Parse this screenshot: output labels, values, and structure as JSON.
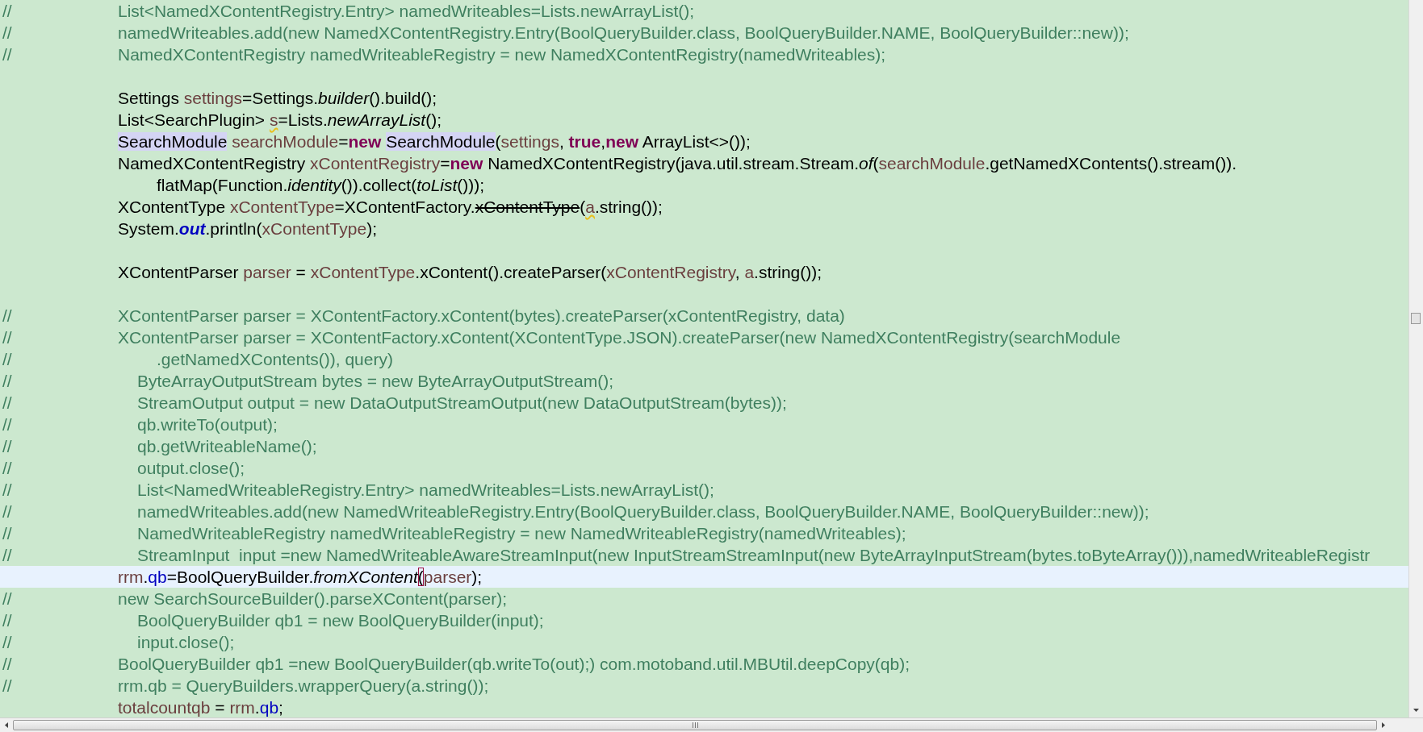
{
  "editor": {
    "lines": [
      {
        "kind": "comment",
        "current": false,
        "marker": "//",
        "text": "List<NamedXContentRegistry.Entry> namedWriteables=Lists.newArrayList();"
      },
      {
        "kind": "comment",
        "current": false,
        "marker": "//",
        "text": "namedWriteables.add(new NamedXContentRegistry.Entry(BoolQueryBuilder.class, BoolQueryBuilder.NAME, BoolQueryBuilder::new));"
      },
      {
        "kind": "comment",
        "current": false,
        "marker": "//",
        "text": "NamedXContentRegistry namedWriteableRegistry = new NamedXContentRegistry(namedWriteables);"
      },
      {
        "kind": "blank",
        "current": false
      },
      {
        "kind": "code",
        "current": false,
        "tokens": [
          {
            "text": "Settings ",
            "kind": "plain"
          },
          {
            "text": "settings",
            "kind": "local"
          },
          {
            "text": "=Settings.",
            "kind": "plain"
          },
          {
            "text": "builder",
            "kind": "static"
          },
          {
            "text": "().build();",
            "kind": "plain"
          }
        ]
      },
      {
        "kind": "code",
        "current": false,
        "tokens": [
          {
            "text": "List<SearchPlugin> ",
            "kind": "plain"
          },
          {
            "text": "s",
            "kind": "local-warning"
          },
          {
            "text": "=Lists.",
            "kind": "plain"
          },
          {
            "text": "newArrayList",
            "kind": "static"
          },
          {
            "text": "();",
            "kind": "plain"
          }
        ]
      },
      {
        "kind": "code",
        "current": false,
        "tokens": [
          {
            "text": "SearchModule",
            "kind": "occurrence"
          },
          {
            "text": " searchModule",
            "kind": "local"
          },
          {
            "text": "=",
            "kind": "plain"
          },
          {
            "text": "new ",
            "kind": "keyword"
          },
          {
            "text": "SearchModule",
            "kind": "occurrence"
          },
          {
            "text": "(",
            "kind": "plain"
          },
          {
            "text": "settings",
            "kind": "local"
          },
          {
            "text": ", ",
            "kind": "plain"
          },
          {
            "text": "true",
            "kind": "keyword"
          },
          {
            "text": ",",
            "kind": "plain"
          },
          {
            "text": "new",
            "kind": "keyword"
          },
          {
            "text": " ArrayList<>());",
            "kind": "plain"
          }
        ]
      },
      {
        "kind": "code",
        "current": false,
        "tokens": [
          {
            "text": "NamedXContentRegistry ",
            "kind": "plain"
          },
          {
            "text": "xContentRegistry",
            "kind": "local"
          },
          {
            "text": "=",
            "kind": "plain"
          },
          {
            "text": "new",
            "kind": "keyword"
          },
          {
            "text": " NamedXContentRegistry(java.util.stream.Stream.",
            "kind": "plain"
          },
          {
            "text": "of",
            "kind": "static"
          },
          {
            "text": "(",
            "kind": "plain"
          },
          {
            "text": "searchModule",
            "kind": "local"
          },
          {
            "text": ".getNamedXContents().stream()).",
            "kind": "plain"
          }
        ]
      },
      {
        "kind": "code-wrapped",
        "current": false,
        "tokens": [
          {
            "text": "flatMap(Function.",
            "kind": "plain"
          },
          {
            "text": "identity",
            "kind": "static"
          },
          {
            "text": "()).collect(",
            "kind": "plain"
          },
          {
            "text": "toList",
            "kind": "static"
          },
          {
            "text": "()));",
            "kind": "plain"
          }
        ]
      },
      {
        "kind": "code",
        "current": false,
        "tokens": [
          {
            "text": "XContentType ",
            "kind": "plain"
          },
          {
            "text": "xContentType",
            "kind": "local"
          },
          {
            "text": "=XContentFactory.",
            "kind": "plain"
          },
          {
            "text": "xContentType",
            "kind": "deprecated"
          },
          {
            "text": "(",
            "kind": "plain"
          },
          {
            "text": "a",
            "kind": "local-warning"
          },
          {
            "text": ".string());",
            "kind": "plain"
          }
        ]
      },
      {
        "kind": "code",
        "current": false,
        "tokens": [
          {
            "text": "System.",
            "kind": "plain"
          },
          {
            "text": "out",
            "kind": "static-field"
          },
          {
            "text": ".println(",
            "kind": "plain"
          },
          {
            "text": "xContentType",
            "kind": "local"
          },
          {
            "text": ");",
            "kind": "plain"
          }
        ]
      },
      {
        "kind": "blank",
        "current": false
      },
      {
        "kind": "code",
        "current": false,
        "tokens": [
          {
            "text": "XContentParser ",
            "kind": "plain"
          },
          {
            "text": "parser",
            "kind": "local"
          },
          {
            "text": " = ",
            "kind": "plain"
          },
          {
            "text": "xContentType",
            "kind": "local"
          },
          {
            "text": ".xContent().createParser(",
            "kind": "plain"
          },
          {
            "text": "xContentRegistry",
            "kind": "local"
          },
          {
            "text": ", ",
            "kind": "plain"
          },
          {
            "text": "a",
            "kind": "local"
          },
          {
            "text": ".string());",
            "kind": "plain"
          }
        ]
      },
      {
        "kind": "blank",
        "current": false
      },
      {
        "kind": "comment",
        "current": false,
        "marker": "//",
        "text": "XContentParser parser = XContentFactory.xContent(bytes).createParser(xContentRegistry, data)"
      },
      {
        "kind": "comment",
        "current": false,
        "marker": "//",
        "text": "XContentParser parser = XContentFactory.xContent(XContentType.JSON).createParser(new NamedXContentRegistry(searchModule"
      },
      {
        "kind": "comment-wrapped",
        "current": false,
        "marker": "//",
        "text": ".getNamedXContents()), query)"
      },
      {
        "kind": "comment-nested",
        "current": false,
        "marker": "//",
        "text": "ByteArrayOutputStream bytes = new ByteArrayOutputStream();"
      },
      {
        "kind": "comment-nested",
        "current": false,
        "marker": "//",
        "text": "StreamOutput output = new DataOutputStreamOutput(new DataOutputStream(bytes));"
      },
      {
        "kind": "comment-nested",
        "current": false,
        "marker": "//",
        "text": "qb.writeTo(output);"
      },
      {
        "kind": "comment-nested",
        "current": false,
        "marker": "//",
        "text": "qb.getWriteableName();"
      },
      {
        "kind": "comment-nested",
        "current": false,
        "marker": "//",
        "text": "output.close();"
      },
      {
        "kind": "comment-nested",
        "current": false,
        "marker": "//",
        "text": "List<NamedWriteableRegistry.Entry> namedWriteables=Lists.newArrayList();"
      },
      {
        "kind": "comment-nested",
        "current": false,
        "marker": "//",
        "text": "namedWriteables.add(new NamedWriteableRegistry.Entry(BoolQueryBuilder.class, BoolQueryBuilder.NAME, BoolQueryBuilder::new));"
      },
      {
        "kind": "comment-nested",
        "current": false,
        "marker": "//",
        "text": "NamedWriteableRegistry namedWriteableRegistry = new NamedWriteableRegistry(namedWriteables);"
      },
      {
        "kind": "comment-nested",
        "current": false,
        "marker": "//",
        "text": "StreamInput  input =new NamedWriteableAwareStreamInput(new InputStreamStreamInput(new ByteArrayInputStream(bytes.toByteArray())),namedWriteableRegistr"
      },
      {
        "kind": "code",
        "current": true,
        "tokens": [
          {
            "text": "rrm",
            "kind": "local"
          },
          {
            "text": ".",
            "kind": "plain"
          },
          {
            "text": "qb",
            "kind": "field"
          },
          {
            "text": "=BoolQueryBuilder.",
            "kind": "plain"
          },
          {
            "text": "fromXContent",
            "kind": "static"
          },
          {
            "text": "(",
            "kind": "bracket-match"
          },
          {
            "text": "parser",
            "kind": "local"
          },
          {
            "text": ");",
            "kind": "plain"
          }
        ]
      },
      {
        "kind": "comment",
        "current": false,
        "marker": "//",
        "text": "new SearchSourceBuilder().parseXContent(parser);"
      },
      {
        "kind": "comment-nested",
        "current": false,
        "marker": "//",
        "text": "BoolQueryBuilder qb1 = new BoolQueryBuilder(input);"
      },
      {
        "kind": "comment-nested",
        "current": false,
        "marker": "//",
        "text": "input.close();"
      },
      {
        "kind": "comment",
        "current": false,
        "marker": "//",
        "text": "BoolQueryBuilder qb1 =new BoolQueryBuilder(qb.writeTo(out);) com.motoband.util.MBUtil.deepCopy(qb);"
      },
      {
        "kind": "comment",
        "current": false,
        "marker": "//",
        "text": "rrm.qb = QueryBuilders.wrapperQuery(a.string());"
      },
      {
        "kind": "code",
        "current": false,
        "tokens": [
          {
            "text": "totalcountqb",
            "kind": "local"
          },
          {
            "text": " = ",
            "kind": "plain"
          },
          {
            "text": "rrm",
            "kind": "local"
          },
          {
            "text": ".",
            "kind": "plain"
          },
          {
            "text": "qb",
            "kind": "field"
          },
          {
            "text": ";",
            "kind": "plain"
          }
        ]
      }
    ]
  }
}
